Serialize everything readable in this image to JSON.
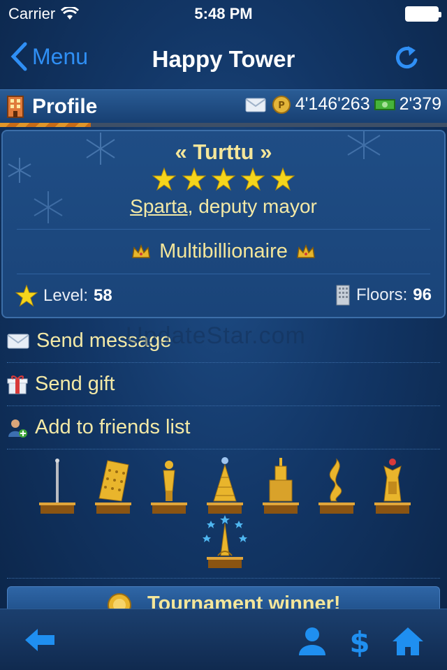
{
  "status_bar": {
    "carrier": "Carrier",
    "time": "5:48 PM"
  },
  "nav": {
    "back_label": "Menu",
    "title": "Happy Tower"
  },
  "profile_header": {
    "title": "Profile",
    "coins": "4'146'263",
    "cash": "2'379"
  },
  "profile": {
    "name": "« Turttu »",
    "stars": 5,
    "city": "Sparta",
    "role": ", deputy mayor",
    "status": "Multibillionaire",
    "level_label": "Level:",
    "level": "58",
    "floors_label": "Floors:",
    "floors": "96"
  },
  "actions": [
    {
      "label": "Send message",
      "icon": "envelope-icon"
    },
    {
      "label": "Send gift",
      "icon": "gift-icon"
    },
    {
      "label": "Add to friends list",
      "icon": "add-friend-icon"
    }
  ],
  "watermark": "UpdateStar.com",
  "trophies": [
    "needle-trophy",
    "brick-trophy",
    "statue-trophy",
    "cone-tower-trophy",
    "skyscraper-trophy",
    "twisted-tower-trophy",
    "temple-tower-trophy",
    "eiffel-tower-trophy"
  ],
  "banner": {
    "title": "Tournament winner!"
  },
  "tab_bar": {
    "items": [
      "back-arrow-icon",
      "person-icon",
      "dollar-icon",
      "home-icon"
    ]
  },
  "colors": {
    "accent_blue": "#2f8ff5",
    "gold_text": "#f4e69a",
    "background": "#123666"
  }
}
